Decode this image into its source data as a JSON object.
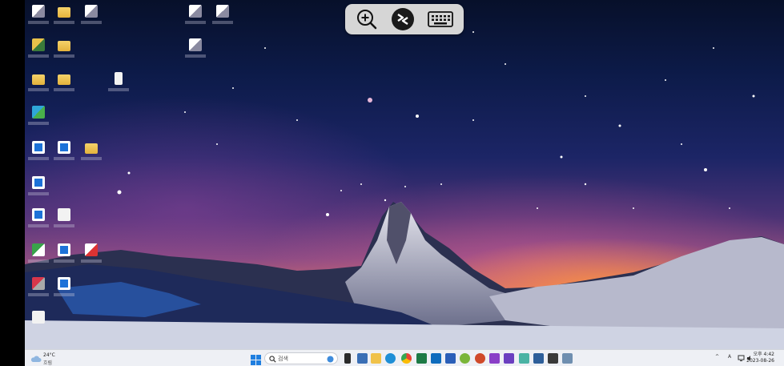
{
  "desktop": {
    "wallpaper": "starry-night-matterhorn"
  },
  "remote_toolbar": {
    "buttons": [
      {
        "name": "zoom-in",
        "icon": "zoom-in-icon"
      },
      {
        "name": "remote-desktop",
        "icon": "remote-desktop-icon"
      },
      {
        "name": "keyboard",
        "icon": "keyboard-icon"
      }
    ]
  },
  "taskbar": {
    "weather": {
      "temp": "24°C",
      "condition": "흐림"
    },
    "search_placeholder": "검색",
    "pinned_apps": [
      "start",
      "search",
      "widgets",
      "file-explorer",
      "mail",
      "folder",
      "edge",
      "chrome",
      "excel",
      "outlook",
      "word",
      "app-green",
      "powerpoint",
      "visual-studio",
      "visual-studio-2",
      "app-teal",
      "app-blue",
      "app-dark",
      "app-orange",
      "app-misc"
    ],
    "tray": {
      "chevron": "^",
      "lang": "A",
      "network_icon": "network-icon",
      "volume_icon": "volume-icon"
    },
    "clock": {
      "time": "오후 4:42",
      "date": "2023-08-26"
    }
  }
}
